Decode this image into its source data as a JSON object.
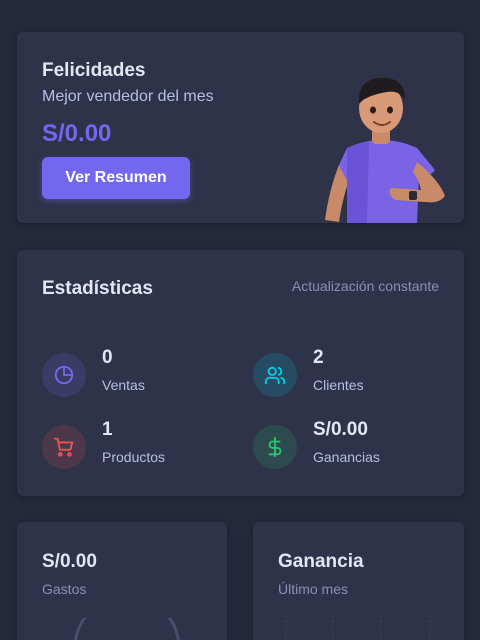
{
  "congrats": {
    "title": "Felicidades",
    "subtitle": "Mejor vendedor del mes",
    "amount": "S/0.00",
    "button_label": "Ver Resumen"
  },
  "stats": {
    "title": "Estadísticas",
    "note": "Actualización constante",
    "items": [
      {
        "value": "0",
        "label": "Ventas",
        "icon": "chart-pie-icon",
        "color": "#7367f0"
      },
      {
        "value": "2",
        "label": "Clientes",
        "icon": "users-icon",
        "color": "#00cfe8"
      },
      {
        "value": "1",
        "label": "Productos",
        "icon": "shopping-cart-icon",
        "color": "#ea5455"
      },
      {
        "value": "S/0.00",
        "label": "Ganancias",
        "icon": "dollar-sign-icon",
        "color": "#28c76f"
      }
    ]
  },
  "expenses": {
    "amount": "S/0.00",
    "label": "Gastos"
  },
  "profit": {
    "title": "Ganancia",
    "subtitle": "Último mes"
  },
  "colors": {
    "background": "#25293c",
    "card": "#2f3349",
    "primary": "#7367f0"
  }
}
